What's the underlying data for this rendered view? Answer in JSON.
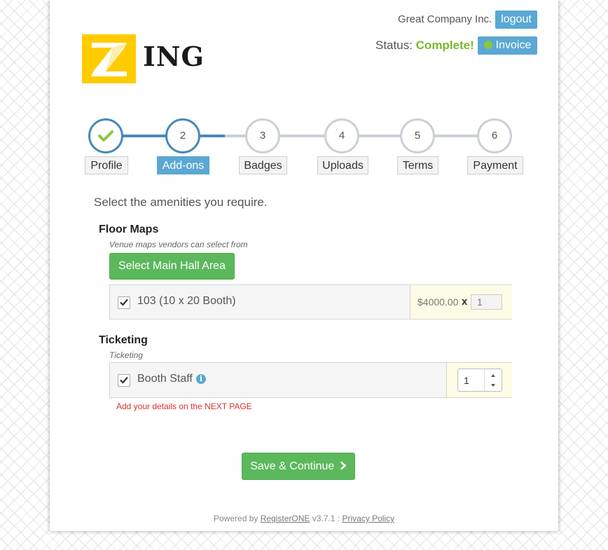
{
  "header": {
    "company": "Great Company Inc.",
    "logout_label": "logout",
    "status_label": "Status:",
    "status_value": "Complete!",
    "invoice_label": "Invoice",
    "logo_text": "ING"
  },
  "steps": [
    {
      "number": "",
      "label": "Profile",
      "state": "done"
    },
    {
      "number": "2",
      "label": "Add-ons",
      "state": "current"
    },
    {
      "number": "3",
      "label": "Badges",
      "state": "pending"
    },
    {
      "number": "4",
      "label": "Uploads",
      "state": "pending"
    },
    {
      "number": "5",
      "label": "Terms",
      "state": "pending"
    },
    {
      "number": "6",
      "label": "Payment",
      "state": "pending"
    }
  ],
  "intro": "Select the amenities you require.",
  "floor_maps": {
    "title": "Floor Maps",
    "subtitle": "Venue maps vendors can select from",
    "select_button": "Select Main Hall Area",
    "item_label": "103 (10 x 20 Booth)",
    "item_checked": true,
    "price": "$4000.00",
    "times": "x",
    "quantity": "1"
  },
  "ticketing": {
    "title": "Ticketing",
    "subtitle": "Ticketing",
    "item_label": "Booth Staff",
    "item_checked": true,
    "quantity": "1",
    "note": "Add your details on the NEXT PAGE"
  },
  "save_button": "Save & Continue",
  "footer": {
    "powered_by": "Powered by",
    "brand": "RegisterONE",
    "version": "v3.7.1 :",
    "privacy": "Privacy Policy"
  },
  "colors": {
    "accent_blue": "#5aa8d3",
    "step_active": "#4a89b8",
    "success_green": "#5cb85c",
    "status_green": "#7ab82a",
    "logo_yellow": "#ffcc00",
    "warning_red": "#d9302c"
  }
}
